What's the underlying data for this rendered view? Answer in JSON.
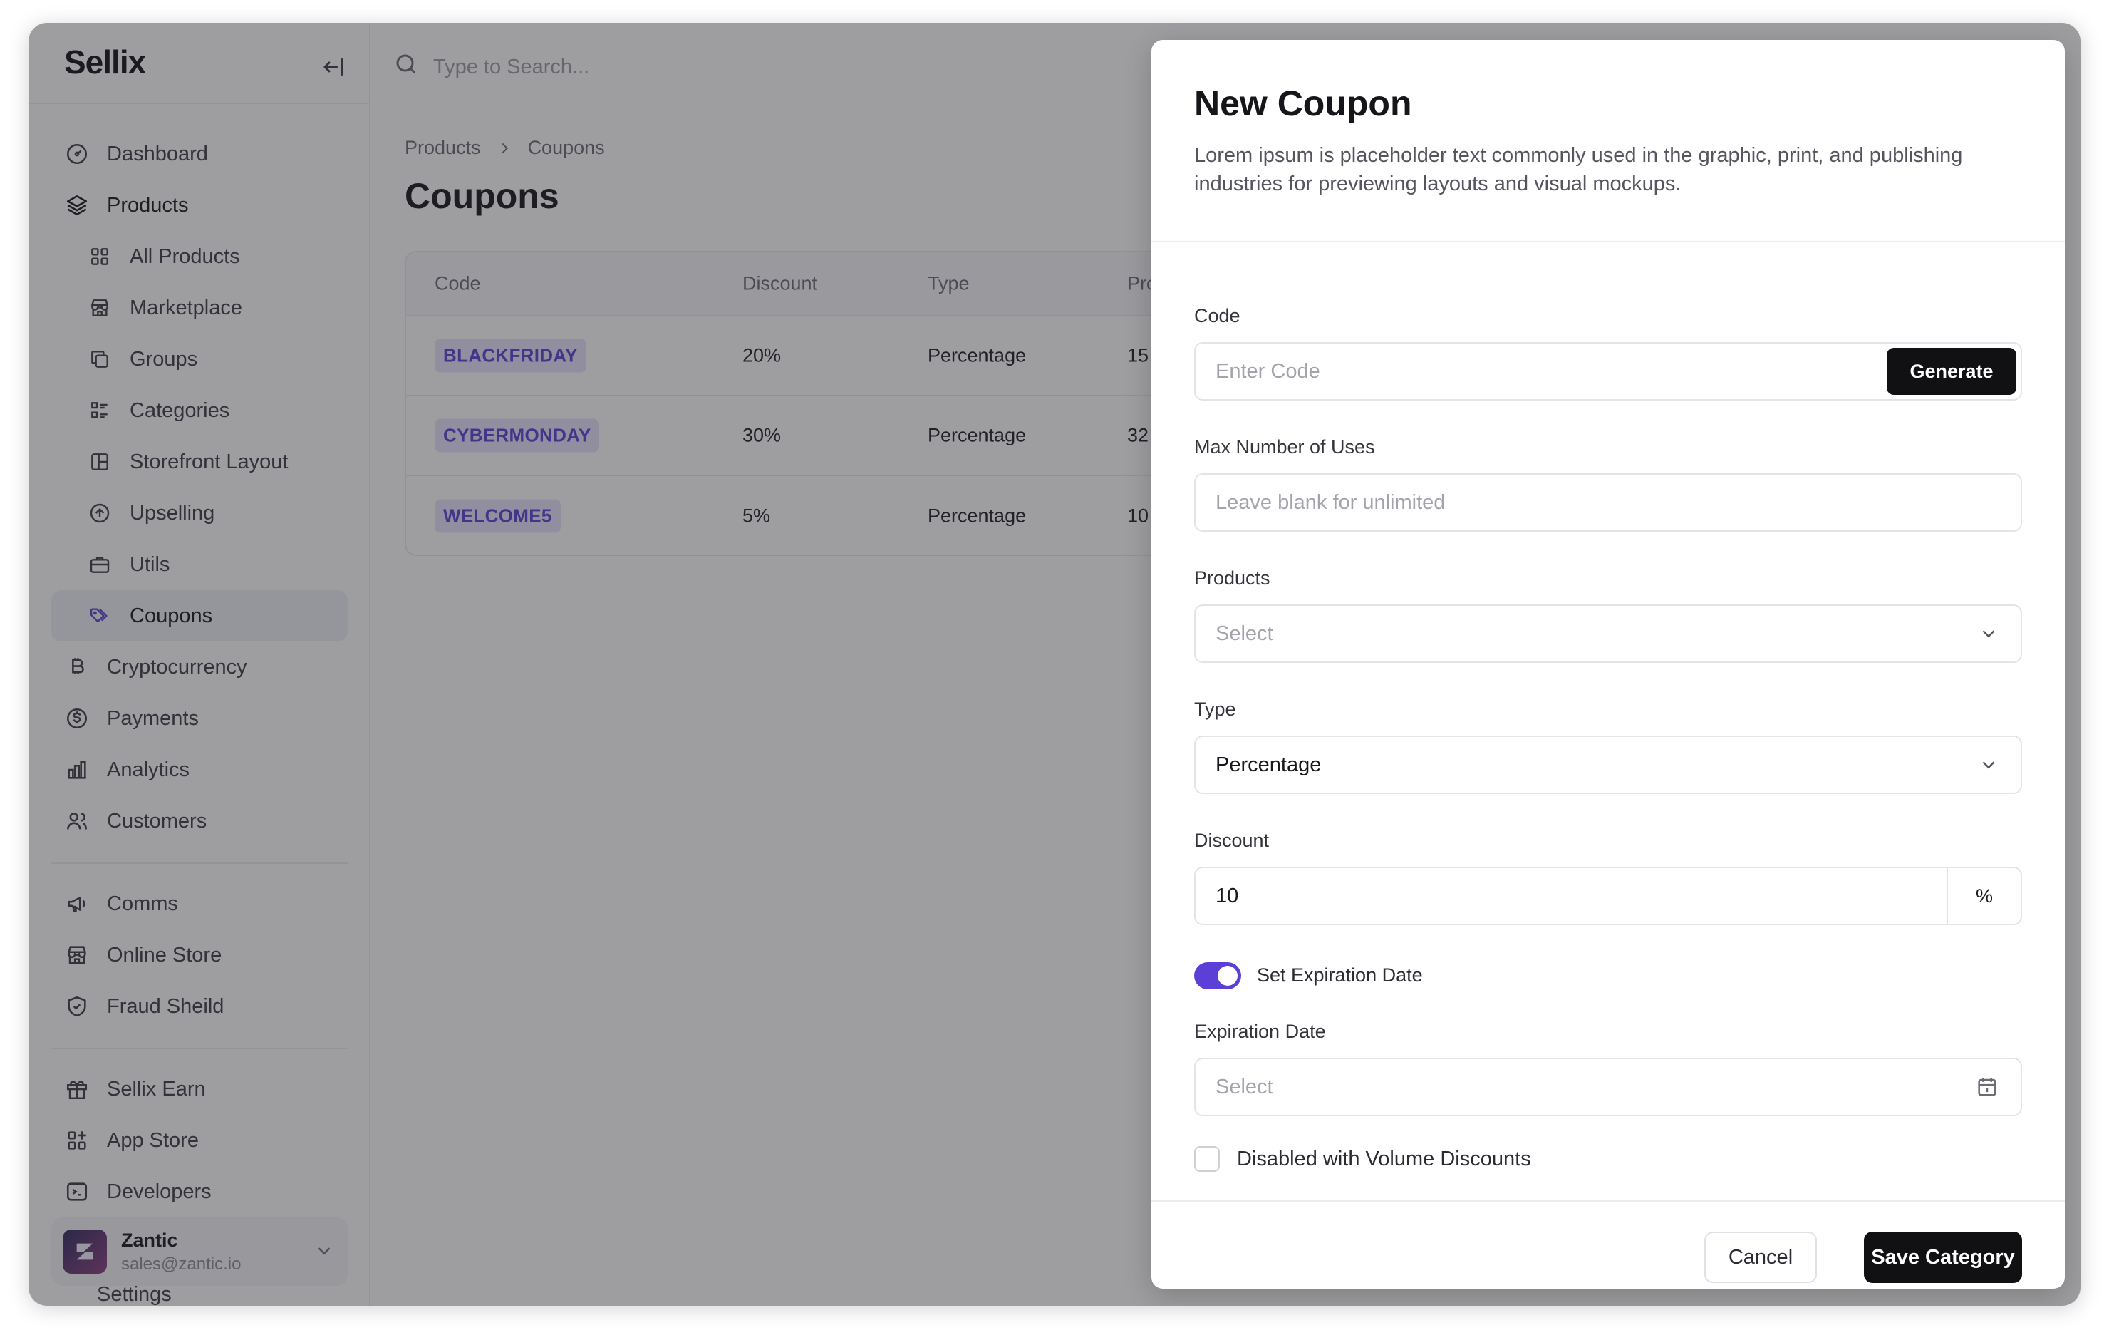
{
  "app": {
    "logo": "Sellix"
  },
  "search": {
    "placeholder": "Type to Search..."
  },
  "sidebar": {
    "items": [
      {
        "label": "Dashboard",
        "icon": "gauge-icon"
      },
      {
        "label": "Products",
        "icon": "layers-icon"
      },
      {
        "label": "All Products",
        "icon": "grid-icon"
      },
      {
        "label": "Marketplace",
        "icon": "store-icon"
      },
      {
        "label": "Groups",
        "icon": "copy-icon"
      },
      {
        "label": "Categories",
        "icon": "list-icon"
      },
      {
        "label": "Storefront Layout",
        "icon": "layout-icon"
      },
      {
        "label": "Upselling",
        "icon": "arrow-up-circle-icon"
      },
      {
        "label": "Utils",
        "icon": "briefcase-icon"
      },
      {
        "label": "Coupons",
        "icon": "tags-icon"
      },
      {
        "label": "Cryptocurrency",
        "icon": "bitcoin-icon"
      },
      {
        "label": "Payments",
        "icon": "dollar-circle-icon"
      },
      {
        "label": "Analytics",
        "icon": "bar-chart-icon"
      },
      {
        "label": "Customers",
        "icon": "users-icon"
      }
    ],
    "section2": [
      {
        "label": "Comms",
        "icon": "megaphone-icon"
      },
      {
        "label": "Online Store",
        "icon": "store-icon"
      },
      {
        "label": "Fraud Sheild",
        "icon": "shield-check-icon"
      }
    ],
    "section3": [
      {
        "label": "Sellix Earn",
        "icon": "gift-icon"
      },
      {
        "label": "App Store",
        "icon": "apps-icon"
      },
      {
        "label": "Developers",
        "icon": "terminal-icon"
      }
    ],
    "settings_label": "Settings",
    "user": {
      "name": "Zantic",
      "email": "sales@zantic.io"
    }
  },
  "breadcrumb": {
    "parent": "Products",
    "current": "Coupons"
  },
  "page": {
    "title": "Coupons"
  },
  "table": {
    "headers": [
      "Code",
      "Discount",
      "Type",
      "Pro"
    ],
    "rows": [
      {
        "code": "BLACKFRIDAY",
        "discount": "20%",
        "type": "Percentage",
        "products": "15"
      },
      {
        "code": "CYBERMONDAY",
        "discount": "30%",
        "type": "Percentage",
        "products": "32"
      },
      {
        "code": "WELCOME5",
        "discount": "5%",
        "type": "Percentage",
        "products": "10"
      }
    ]
  },
  "modal": {
    "title": "New Coupon",
    "description": "Lorem ipsum is placeholder text commonly used in the graphic, print, and publishing industries for previewing layouts and visual mockups.",
    "code_label": "Code",
    "code_placeholder": "Enter Code",
    "generate_label": "Generate",
    "max_uses_label": "Max Number of Uses",
    "max_uses_placeholder": "Leave blank for unlimited",
    "products_label": "Products",
    "products_value": "Select",
    "type_label": "Type",
    "type_value": "Percentage",
    "discount_label": "Discount",
    "discount_value": "10",
    "discount_suffix": "%",
    "expiration_toggle_label": "Set Expiration Date",
    "expiration_toggle_on": true,
    "expiration_label": "Expiration Date",
    "expiration_value": "Select",
    "volume_label": "Disabled with Volume Discounts",
    "volume_checked": false,
    "cancel_label": "Cancel",
    "save_label": "Save Category"
  },
  "colors": {
    "accent": "#5b3fd6",
    "primary_button": "#111114",
    "badge_bg": "#e7e2fb"
  }
}
